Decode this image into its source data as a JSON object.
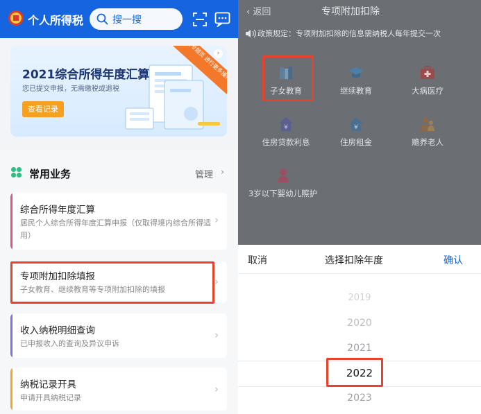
{
  "left_app": {
    "title": "个人所得税",
    "search_placeholder": "搜一搜",
    "banner": {
      "title": "2021综合所得年度汇算",
      "subtitle": "您已提交申报，无需缴税或退税",
      "button": "查看记录",
      "ribbon": "进入专题页 进行更多操作"
    },
    "section": {
      "title": "常用业务",
      "manage": "管理"
    },
    "cards": [
      {
        "title": "综合所得年度汇算",
        "desc": "居民个人综合所得年度汇算申报（仅取得境内综合所得适用）",
        "accent": "#e8527a"
      },
      {
        "title": "专项附加扣除填报",
        "desc": "子女教育、继续教育等专项附加扣除的填报",
        "accent": "#2ebd85"
      },
      {
        "title": "收入纳税明细查询",
        "desc": "已申报收入的查询及异议申诉",
        "accent": "#7b6cf6"
      },
      {
        "title": "纳税记录开具",
        "desc": "申请开具纳税记录",
        "accent": "#f5a623"
      }
    ]
  },
  "right_app": {
    "back": "返回",
    "title": "专项附加扣除",
    "notice": "政策规定：专项附加扣除的信息需纳税人每年提交一次",
    "categories": [
      {
        "label": "子女教育",
        "icon": "child-education-icon"
      },
      {
        "label": "继续教育",
        "icon": "graduation-cap-icon"
      },
      {
        "label": "大病医疗",
        "icon": "medical-kit-icon"
      },
      {
        "label": "住房贷款利息",
        "icon": "house-loan-icon"
      },
      {
        "label": "住房租金",
        "icon": "house-rent-icon"
      },
      {
        "label": "赡养老人",
        "icon": "elderly-care-icon"
      },
      {
        "label": "3岁以下婴幼儿照护",
        "icon": "infant-care-icon"
      }
    ],
    "picker": {
      "cancel": "取消",
      "title": "选择扣除年度",
      "confirm": "确认",
      "years": [
        "2019",
        "2020",
        "2021",
        "2022",
        "2023"
      ],
      "selected": "2022"
    }
  },
  "colors": {
    "brand_blue": "#1565e0",
    "highlight_red": "#e8412c",
    "banner_button": "#f5a020"
  }
}
